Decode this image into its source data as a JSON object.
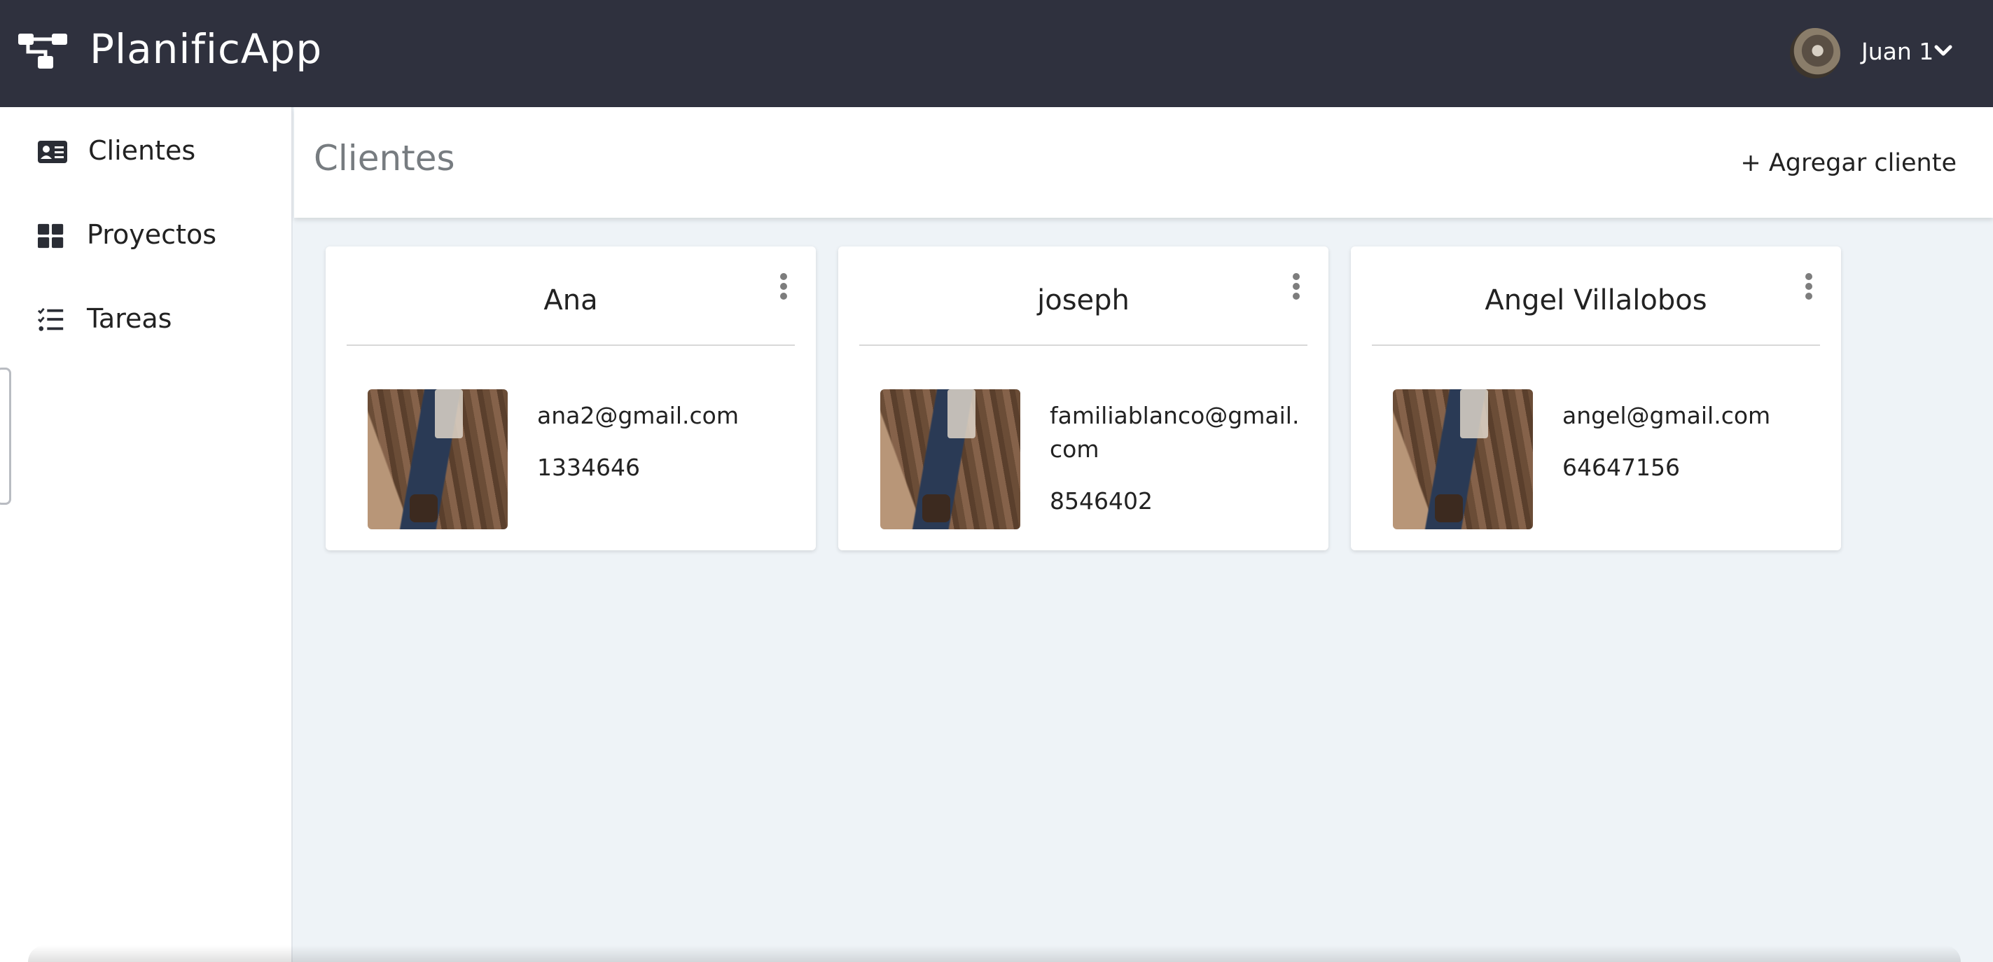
{
  "app": {
    "title": "PlanificApp",
    "logo_icon": "sitemap-icon"
  },
  "user": {
    "name": "Juan 1",
    "avatar_icon": "user-avatar",
    "menu_icon": "chevron-down-icon"
  },
  "sidebar": {
    "items": [
      {
        "label": "Clientes",
        "icon": "id-card-icon"
      },
      {
        "label": "Proyectos",
        "icon": "grid-icon"
      },
      {
        "label": "Tareas",
        "icon": "tasks-icon"
      }
    ]
  },
  "main": {
    "title": "Clientes",
    "add_button": "+ Agregar cliente"
  },
  "clients": [
    {
      "name": "Ana",
      "email": "ana2@gmail.com",
      "phone": "1334646"
    },
    {
      "name": "joseph",
      "email": "familiablanco@gmail.com",
      "phone": "8546402"
    },
    {
      "name": "Angel Villalobos",
      "email": "angel@gmail.com",
      "phone": "64647156"
    }
  ],
  "colors": {
    "navbar": "#2f313e",
    "background": "#eef3f7",
    "card": "#ffffff",
    "title_muted": "#777c80"
  }
}
